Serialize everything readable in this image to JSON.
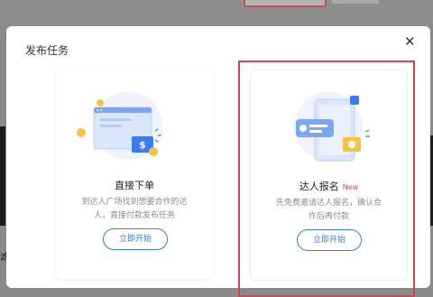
{
  "modal": {
    "title": "发布任务",
    "close_icon": "close-icon"
  },
  "options": [
    {
      "title": "直接下单",
      "badge": "",
      "description": "到达人广场找到想要合作的达人，直接付款发布任务",
      "button_label": "立即开始",
      "illustration": "browser-payment-illustration"
    },
    {
      "title": "达人报名",
      "badge": "New",
      "description": "先免费邀请达人报名，确认合作后再付款",
      "button_label": "立即开始",
      "illustration": "phone-invite-illustration"
    }
  ],
  "colors": {
    "primary": "#3a7bf6",
    "highlight": "#d9434e",
    "badge": "#e5484d",
    "coin": "#f5c242"
  }
}
